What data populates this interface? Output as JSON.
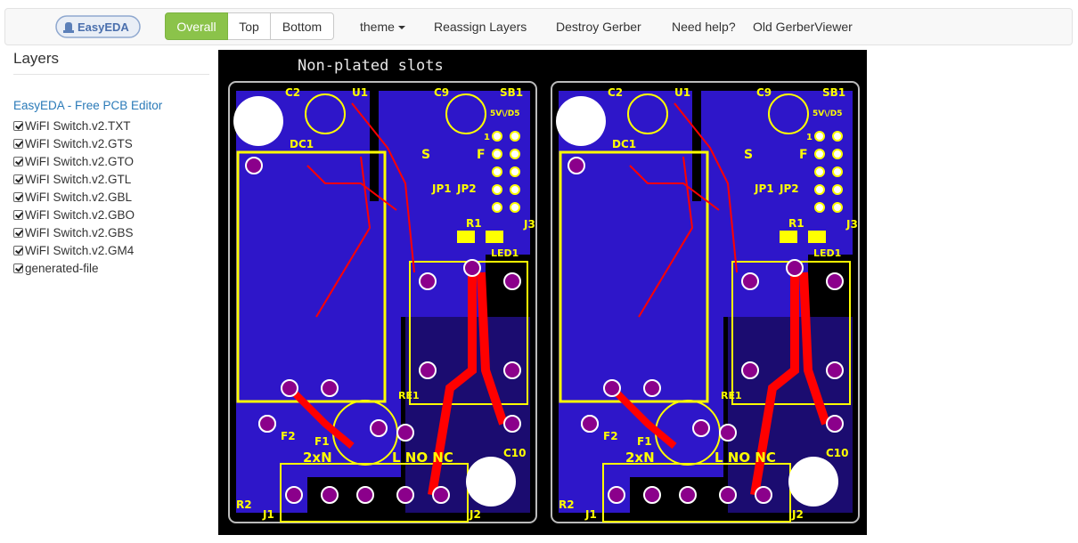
{
  "logo": {
    "text": "EasyEDA"
  },
  "view_toggle": {
    "overall": "Overall",
    "top": "Top",
    "bottom": "Bottom"
  },
  "nav": {
    "theme": "theme",
    "reassign": "Reassign Layers",
    "destroy": "Destroy Gerber",
    "help": "Need help?",
    "old_viewer": "Old GerberViewer"
  },
  "sidebar": {
    "title": "Layers",
    "editor_link": "EasyEDA - Free PCB Editor",
    "layers": [
      "WiFI Switch.v2.TXT",
      "WiFI Switch.v2.GTS",
      "WiFI Switch.v2.GTO",
      "WiFI Switch.v2.GTL",
      "WiFI Switch.v2.GBL",
      "WiFI Switch.v2.GBO",
      "WiFI Switch.v2.GBS",
      "WiFI Switch.v2.GM4",
      "generated-file"
    ]
  },
  "board": {
    "header": "Non-plated slots",
    "labels": {
      "c2": "C2",
      "u1": "U1",
      "c9": "C9",
      "sb1": "SB1",
      "sb1_opts": "5V\\/D5",
      "dc1": "DC1",
      "s": "S",
      "f": "F",
      "jp1": "JP1",
      "jp2": "JP2",
      "r1": "R1",
      "j3": "J3",
      "led1": "LED1",
      "re1": "RE1",
      "f2": "F2",
      "f1": "F1",
      "two_x_n": "2xN",
      "l_no_nc": "L NO NC",
      "c10": "C10",
      "r2": "R2",
      "j1": "J1",
      "j2": "J2",
      "one": "1"
    },
    "colors": {
      "background": "#000000",
      "pcb": "#2e16c9",
      "silk": "#ffff00",
      "trace": "#ff0000",
      "pad": "#8b008b"
    }
  }
}
